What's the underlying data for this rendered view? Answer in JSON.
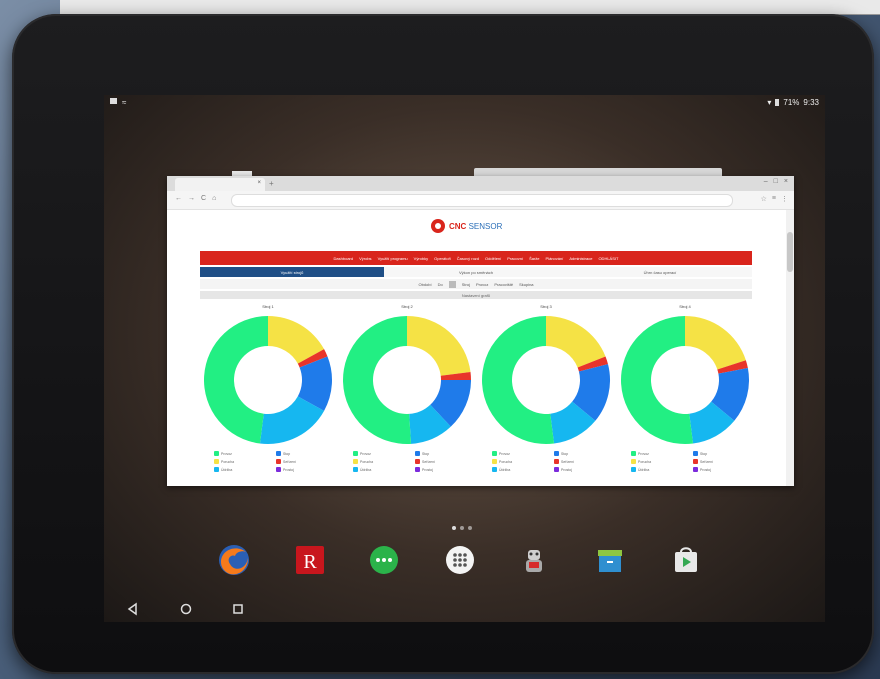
{
  "status_bar": {
    "battery_text": "71%",
    "time": "9:33"
  },
  "browser": {
    "tab_close": "×",
    "new_tab": "+",
    "window_controls": [
      "–",
      "□",
      "×"
    ],
    "nav_buttons": [
      "←",
      "→",
      "C",
      "⌂"
    ],
    "tools": [
      "☆",
      "≡",
      "⋮"
    ]
  },
  "site": {
    "logo_brand": "CNC",
    "logo_suffix": "SENSOR",
    "main_menu": [
      "Dashboard",
      "Výrobs",
      "Využití programu",
      "Výrobky",
      "Operátoři",
      "Časový rozd",
      "Oddělení",
      "Pracovní",
      "Šarže",
      "Plánování",
      "Administrace",
      "ODHLÁSIT"
    ],
    "sub_tabs": [
      {
        "label": "Využití strojů",
        "active": true
      },
      {
        "label": "Výkon po směnách",
        "active": false
      },
      {
        "label": "Úhrn času operací",
        "active": false
      }
    ],
    "filters": [
      "Období",
      "Do",
      "Stroj",
      "Provoz",
      "Pracoviště",
      "Skupina"
    ],
    "show_bar": "Nastavení grafů"
  },
  "chart_data": [
    {
      "type": "pie",
      "title": "Stroj 1",
      "categories": [
        "Provoz",
        "Porucha",
        "Seřízení",
        "Stop",
        "Údržba",
        "Prostoj"
      ],
      "values": [
        48,
        17,
        2,
        14,
        19,
        0
      ]
    },
    {
      "type": "pie",
      "title": "Stroj 2",
      "categories": [
        "Provoz",
        "Porucha",
        "Seřízení",
        "Stop",
        "Údržba",
        "Prostoj"
      ],
      "values": [
        51,
        23,
        2,
        13,
        11,
        0
      ]
    },
    {
      "type": "pie",
      "title": "Stroj 3",
      "categories": [
        "Provoz",
        "Porucha",
        "Seřízení",
        "Stop",
        "Údržba",
        "Prostoj"
      ],
      "values": [
        52,
        19,
        2,
        15,
        12,
        0
      ]
    },
    {
      "type": "pie",
      "title": "Stroj 4",
      "categories": [
        "Provoz",
        "Porucha",
        "Seřízení",
        "Stop",
        "Údržba",
        "Prostoj"
      ],
      "values": [
        52,
        20,
        2,
        14,
        12,
        0
      ]
    }
  ],
  "colors": {
    "running": "#22ef83",
    "yellow": "#f5e245",
    "red": "#e8342a",
    "blue": "#1f7bea",
    "cyan": "#16b7f0",
    "purple": "#7b2bdc",
    "brand_red": "#d9251c",
    "brand_navy": "#1f4f86"
  },
  "dock": {
    "apps": [
      "firefox-icon",
      "r-app-icon",
      "messenger-icon",
      "app-drawer-icon",
      "robot-app-icon",
      "archive-app-icon",
      "play-store-icon"
    ]
  },
  "navbar": {
    "buttons": [
      "back-icon",
      "home-icon",
      "recents-icon"
    ]
  }
}
